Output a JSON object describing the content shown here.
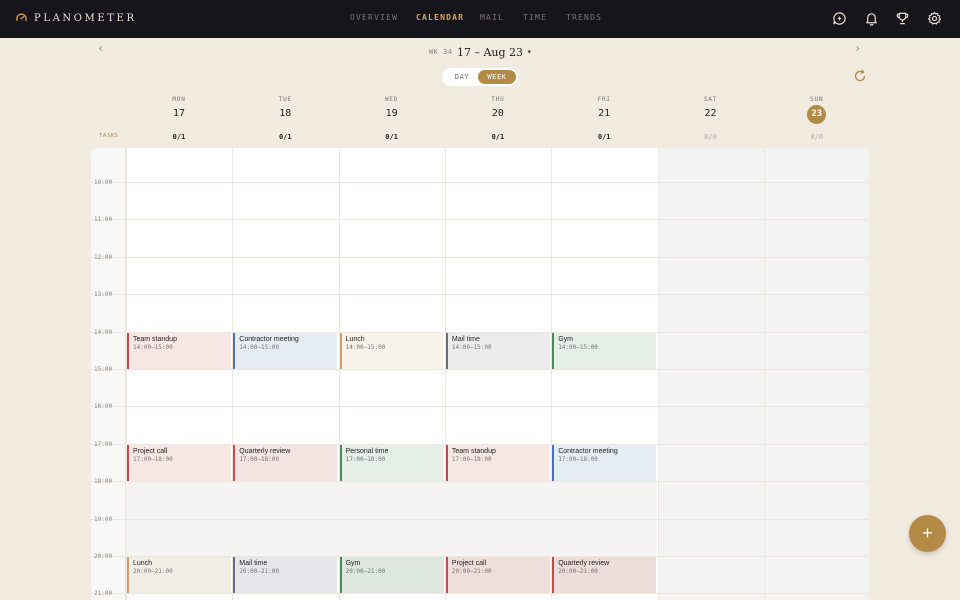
{
  "app": {
    "name": "PLANOMETER"
  },
  "nav": [
    {
      "label": "OVERVIEW",
      "active": false
    },
    {
      "label": "CALENDAR",
      "active": true
    },
    {
      "label": "MAIL",
      "active": false
    },
    {
      "label": "TIME",
      "active": false
    },
    {
      "label": "TRENDS",
      "active": false
    }
  ],
  "icons": [
    "assistant-icon",
    "bell-icon",
    "trophy-icon",
    "gear-icon"
  ],
  "week": {
    "prefix": "WK 34",
    "range": "17 – Aug 23",
    "caret": "▾",
    "prev": "‹",
    "next": "›"
  },
  "view_toggle": {
    "day": "DAY",
    "week": "WEEK",
    "selected": "WEEK"
  },
  "tasks_label": "TASKS",
  "days": [
    {
      "dow": "MON",
      "date": "17",
      "tasks": "0/1",
      "weekend": false,
      "today": false
    },
    {
      "dow": "TUE",
      "date": "18",
      "tasks": "0/1",
      "weekend": false,
      "today": false
    },
    {
      "dow": "WED",
      "date": "19",
      "tasks": "0/1",
      "weekend": false,
      "today": false
    },
    {
      "dow": "THU",
      "date": "20",
      "tasks": "0/1",
      "weekend": false,
      "today": false
    },
    {
      "dow": "FRI",
      "date": "21",
      "tasks": "0/1",
      "weekend": false,
      "today": false
    },
    {
      "dow": "SAT",
      "date": "22",
      "tasks": "0/0",
      "weekend": true,
      "today": false
    },
    {
      "dow": "SUN",
      "date": "23",
      "tasks": "0/0",
      "weekend": true,
      "today": true
    }
  ],
  "hours": [
    "10:00",
    "11:00",
    "12:00",
    "13:00",
    "14:00",
    "15:00",
    "16:00",
    "17:00",
    "18:00",
    "19:00",
    "20:00",
    "21:00"
  ],
  "events": [
    {
      "day": 0,
      "start": 14,
      "title": "Team standup",
      "time": "14:00–15:00",
      "color": "#c64a4a",
      "bg": "#f6e6e4"
    },
    {
      "day": 1,
      "start": 14,
      "title": "Contractor meeting",
      "time": "14:00–15:00",
      "color": "#4a6fc0",
      "bg": "#e6ecf4"
    },
    {
      "day": 2,
      "start": 14,
      "title": "Lunch",
      "time": "14:00–15:00",
      "color": "#caa070",
      "bg": "#f7f2ea"
    },
    {
      "day": 3,
      "start": 14,
      "title": "Mail time",
      "time": "14:00–15:00",
      "color": "#6a6a80",
      "bg": "#ececee"
    },
    {
      "day": 4,
      "start": 14,
      "title": "Gym",
      "time": "14:00–15:00",
      "color": "#4a8a5a",
      "bg": "#e6eee8"
    },
    {
      "day": 0,
      "start": 17,
      "title": "Project call",
      "time": "17:00–18:00",
      "color": "#c64a4a",
      "bg": "#f6e6e4"
    },
    {
      "day": 1,
      "start": 17,
      "title": "Quarterly review",
      "time": "17:00–18:00",
      "color": "#c64a4a",
      "bg": "#f4e4e2"
    },
    {
      "day": 2,
      "start": 17,
      "title": "Personal time",
      "time": "17:00–18:00",
      "color": "#4a8a5a",
      "bg": "#e6eee8"
    },
    {
      "day": 3,
      "start": 17,
      "title": "Team standup",
      "time": "17:00–18:00",
      "color": "#c64a4a",
      "bg": "#f6e6e4"
    },
    {
      "day": 4,
      "start": 17,
      "title": "Contractor meeting",
      "time": "17:00–18:00",
      "color": "#4a6fc0",
      "bg": "#e6ecf4"
    },
    {
      "day": 0,
      "start": 20,
      "title": "Lunch",
      "time": "20:00–21:00",
      "color": "#caa070",
      "bg": "#f2ede4"
    },
    {
      "day": 1,
      "start": 20,
      "title": "Mail time",
      "time": "20:00–21:00",
      "color": "#6a6a80",
      "bg": "#e6e6ea"
    },
    {
      "day": 2,
      "start": 20,
      "title": "Gym",
      "time": "20:00–21:00",
      "color": "#4a8a5a",
      "bg": "#dde6df"
    },
    {
      "day": 3,
      "start": 20,
      "title": "Project call",
      "time": "20:00–21:00",
      "color": "#c64a4a",
      "bg": "#f0dedc"
    },
    {
      "day": 4,
      "start": 20,
      "title": "Quarterly review",
      "time": "20:00–21:00",
      "color": "#c64a4a",
      "bg": "#eedcda"
    }
  ],
  "fab": {
    "label": "+"
  }
}
